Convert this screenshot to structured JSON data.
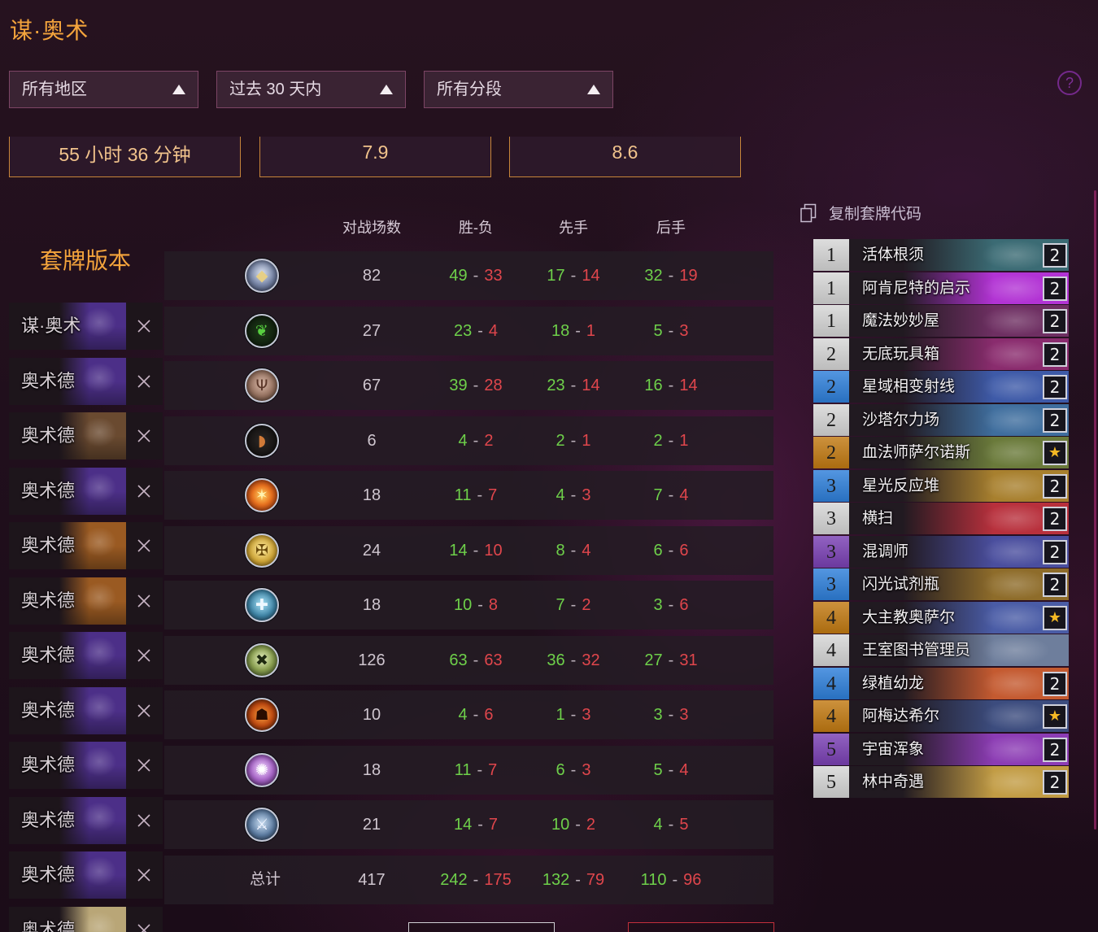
{
  "title": "谋·奥术",
  "filters": [
    {
      "label": "所有地区",
      "icon": "triangle-up-icon"
    },
    {
      "label": "过去 30 天内",
      "icon": "triangle-up-icon"
    },
    {
      "label": "所有分段",
      "icon": "triangle-up-icon"
    }
  ],
  "help": {
    "label": "?",
    "icon": "help-circle-icon"
  },
  "stats": [
    {
      "value": "55 小时 36 分钟"
    },
    {
      "value": "7.9"
    },
    {
      "value": "8.6"
    }
  ],
  "table": {
    "section_title": "套牌版本",
    "headers": {
      "games": "对战场数",
      "win_loss": "胜-负",
      "first": "先手",
      "second": "后手"
    },
    "separator": "-",
    "rows": [
      {
        "class_icon": "death-knight-icon",
        "games": 82,
        "win_loss": [
          49,
          33
        ],
        "first": [
          17,
          14
        ],
        "second": [
          32,
          19
        ]
      },
      {
        "class_icon": "demon-hunter-icon",
        "games": 27,
        "win_loss": [
          23,
          4
        ],
        "first": [
          18,
          1
        ],
        "second": [
          5,
          3
        ]
      },
      {
        "class_icon": "druid-icon",
        "games": 67,
        "win_loss": [
          39,
          28
        ],
        "first": [
          23,
          14
        ],
        "second": [
          16,
          14
        ]
      },
      {
        "class_icon": "hunter-icon",
        "games": 6,
        "win_loss": [
          4,
          2
        ],
        "first": [
          2,
          1
        ],
        "second": [
          2,
          1
        ]
      },
      {
        "class_icon": "mage-icon",
        "games": 18,
        "win_loss": [
          11,
          7
        ],
        "first": [
          4,
          3
        ],
        "second": [
          7,
          4
        ]
      },
      {
        "class_icon": "paladin-icon",
        "games": 24,
        "win_loss": [
          14,
          10
        ],
        "first": [
          8,
          4
        ],
        "second": [
          6,
          6
        ]
      },
      {
        "class_icon": "priest-icon",
        "games": 18,
        "win_loss": [
          10,
          8
        ],
        "first": [
          7,
          2
        ],
        "second": [
          3,
          6
        ]
      },
      {
        "class_icon": "rogue-icon",
        "games": 126,
        "win_loss": [
          63,
          63
        ],
        "first": [
          36,
          32
        ],
        "second": [
          27,
          31
        ]
      },
      {
        "class_icon": "shaman-icon",
        "games": 10,
        "win_loss": [
          4,
          6
        ],
        "first": [
          1,
          3
        ],
        "second": [
          3,
          3
        ]
      },
      {
        "class_icon": "warlock-icon",
        "games": 18,
        "win_loss": [
          11,
          7
        ],
        "first": [
          6,
          3
        ],
        "second": [
          5,
          4
        ]
      },
      {
        "class_icon": "warrior-icon",
        "games": 21,
        "win_loss": [
          14,
          7
        ],
        "first": [
          10,
          2
        ],
        "second": [
          4,
          5
        ]
      },
      {
        "label": "总计",
        "games": 417,
        "win_loss": [
          242,
          175
        ],
        "first": [
          132,
          79
        ],
        "second": [
          110,
          96
        ]
      }
    ]
  },
  "deck_versions": [
    {
      "name": "谋·奥术",
      "art_color": "#4c2f88"
    },
    {
      "name": "奥术德",
      "art_color": "#4c2f88"
    },
    {
      "name": "奥术德",
      "art_color": "#6a4a30"
    },
    {
      "name": "奥术德",
      "art_color": "#4c2f88"
    },
    {
      "name": "奥术德",
      "art_color": "#9a5a22"
    },
    {
      "name": "奥术德",
      "art_color": "#9a5a22"
    },
    {
      "name": "奥术德",
      "art_color": "#4c2f88"
    },
    {
      "name": "奥术德",
      "art_color": "#4c2f88"
    },
    {
      "name": "奥术德",
      "art_color": "#4c2f88"
    },
    {
      "name": "奥术德",
      "art_color": "#4c2f88"
    },
    {
      "name": "奥术德",
      "art_color": "#4c2f88"
    },
    {
      "name": "奥术德",
      "art_color": "#b9a677"
    }
  ],
  "deck_list": {
    "copy_label": "复制套牌代码",
    "cards": [
      {
        "cost": 1,
        "name": "活体根须",
        "count": "2",
        "cost_color": "#d6d6d6",
        "art_color": "#3b6b74"
      },
      {
        "cost": 1,
        "name": "阿肯尼特的启示",
        "count": "2",
        "cost_color": "#d6d6d6",
        "art_color": "#b233d4"
      },
      {
        "cost": 1,
        "name": "魔法妙妙屋",
        "count": "2",
        "cost_color": "#d6d6d6",
        "art_color": "#6e2f62"
      },
      {
        "cost": 2,
        "name": "无底玩具箱",
        "count": "2",
        "cost_color": "#d6d6d6",
        "art_color": "#8a2c6e"
      },
      {
        "cost": 2,
        "name": "星域相变射线",
        "count": "2",
        "cost_color": "#2e7fda",
        "art_color": "#3e5aa8"
      },
      {
        "cost": 2,
        "name": "沙塔尔力场",
        "count": "2",
        "cost_color": "#d6d6d6",
        "art_color": "#3f6e9e"
      },
      {
        "cost": 2,
        "name": "血法师萨尔诺斯",
        "count": "★",
        "cost_color": "#c27a12",
        "art_color": "#6a7a3a"
      },
      {
        "cost": 3,
        "name": "星光反应堆",
        "count": "2",
        "cost_color": "#2e7fda",
        "art_color": "#a8802e"
      },
      {
        "cost": 3,
        "name": "横扫",
        "count": "2",
        "cost_color": "#d6d6d6",
        "art_color": "#b8303c"
      },
      {
        "cost": 3,
        "name": "混调师",
        "count": "2",
        "cost_color": "#7a40b4",
        "art_color": "#4a4e9e"
      },
      {
        "cost": 3,
        "name": "闪光试剂瓶",
        "count": "2",
        "cost_color": "#2e7fda",
        "art_color": "#8e6c2a"
      },
      {
        "cost": 4,
        "name": "大主教奥萨尔",
        "count": "★",
        "cost_color": "#c27a12",
        "art_color": "#4a5ca6"
      },
      {
        "cost": 4,
        "name": "王室图书管理员",
        "count": null,
        "cost_color": "#d6d6d6",
        "art_color": "#6e7e9c"
      },
      {
        "cost": 4,
        "name": "绿植幼龙",
        "count": "2",
        "cost_color": "#2e7fda",
        "art_color": "#c45a30"
      },
      {
        "cost": 4,
        "name": "阿梅达希尔",
        "count": "★",
        "cost_color": "#c27a12",
        "art_color": "#3c4c7e"
      },
      {
        "cost": 5,
        "name": "宇宙浑象",
        "count": "2",
        "cost_color": "#7a40b4",
        "art_color": "#8c3cb4"
      },
      {
        "cost": 5,
        "name": "林中奇遇",
        "count": "2",
        "cost_color": "#d6d6d6",
        "art_color": "#c29c44"
      }
    ]
  },
  "colors": {
    "accent": "#f4a43c",
    "win": "#6ed04a",
    "loss": "#e0464c",
    "stat_border": "#c7853a"
  }
}
